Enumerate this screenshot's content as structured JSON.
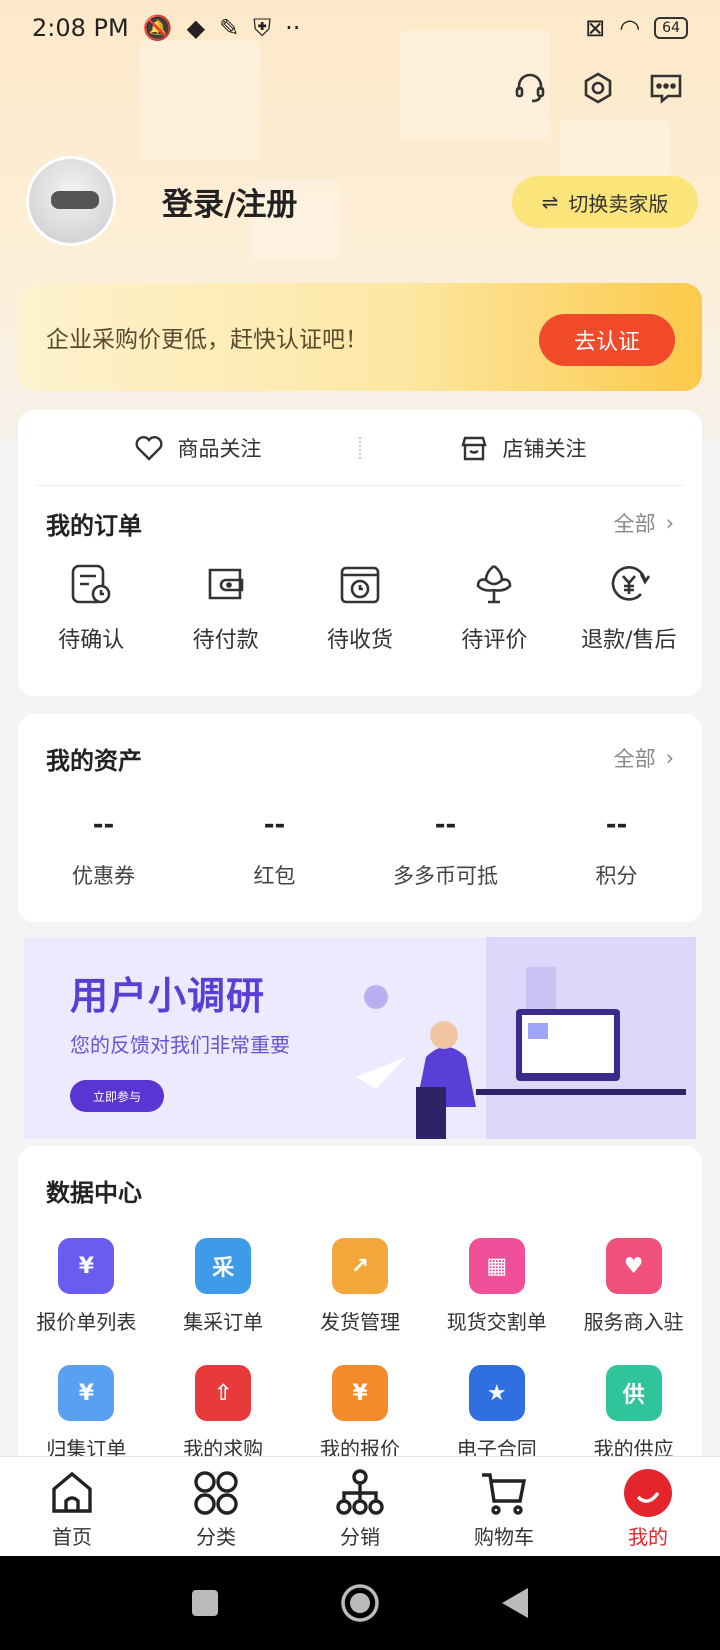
{
  "status_bar": {
    "time": "2:08 PM",
    "battery": "64"
  },
  "profile": {
    "login_label": "登录/注册",
    "switch_label": "切换卖家版"
  },
  "verify_banner": {
    "message": "企业采购价更低，赶快认证吧！",
    "button": "去认证"
  },
  "follow": [
    {
      "label": "商品关注",
      "icon": "heart-icon"
    },
    {
      "label": "店铺关注",
      "icon": "store-icon"
    }
  ],
  "orders": {
    "title": "我的订单",
    "more": "全部",
    "items": [
      {
        "label": "待确认",
        "icon": "pending-confirm-icon"
      },
      {
        "label": "待付款",
        "icon": "wallet-icon"
      },
      {
        "label": "待收货",
        "icon": "package-clock-icon"
      },
      {
        "label": "待评价",
        "icon": "flower-icon"
      },
      {
        "label": "退款/售后",
        "icon": "refund-icon"
      }
    ]
  },
  "assets": {
    "title": "我的资产",
    "more": "全部",
    "items": [
      {
        "value": "--",
        "label": "优惠券"
      },
      {
        "value": "--",
        "label": "红包"
      },
      {
        "value": "--",
        "label": "多多币可抵"
      },
      {
        "value": "--",
        "label": "积分"
      }
    ]
  },
  "survey": {
    "title": "用户小调研",
    "subtitle": "您的反馈对我们非常重要",
    "button": "立即参与"
  },
  "data_center": {
    "title": "数据中心",
    "items": [
      {
        "label": "报价单列表",
        "glyph": "¥",
        "color": "#6a5cf0"
      },
      {
        "label": "集采订单",
        "glyph": "采",
        "color": "#3d9be8"
      },
      {
        "label": "发货管理",
        "glyph": "↗",
        "color": "#f3a73a"
      },
      {
        "label": "现货交割单",
        "glyph": "▦",
        "color": "#f0509a"
      },
      {
        "label": "服务商入驻",
        "glyph": "♥",
        "color": "#f0507a"
      },
      {
        "label": "归集订单",
        "glyph": "¥",
        "color": "#5aa0f0"
      },
      {
        "label": "我的求购",
        "glyph": "⇧",
        "color": "#e83a3a"
      },
      {
        "label": "我的报价",
        "glyph": "¥",
        "color": "#f58a2a"
      },
      {
        "label": "电子合同",
        "glyph": "★",
        "color": "#2f6fe0"
      },
      {
        "label": "我的供应",
        "glyph": "供",
        "color": "#2fc49a"
      }
    ]
  },
  "tabs": [
    {
      "label": "首页",
      "icon": "home-icon"
    },
    {
      "label": "分类",
      "icon": "category-icon"
    },
    {
      "label": "分销",
      "icon": "distribution-icon"
    },
    {
      "label": "购物车",
      "icon": "cart-icon"
    },
    {
      "label": "我的",
      "icon": "profile-icon",
      "active": true
    }
  ]
}
